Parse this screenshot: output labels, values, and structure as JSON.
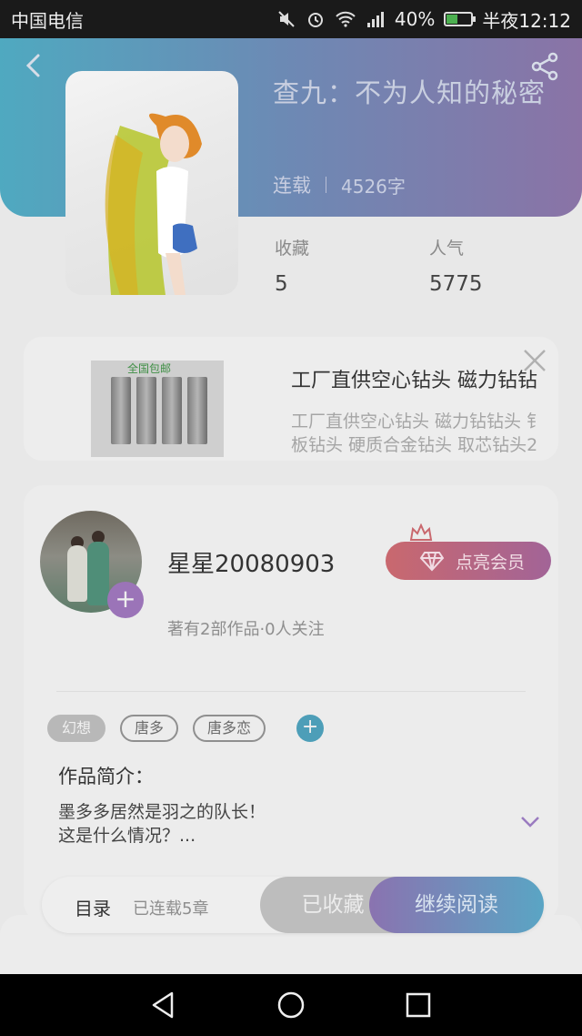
{
  "status_bar": {
    "carrier": "中国电信",
    "battery": "40%",
    "time": "半夜12:12"
  },
  "book": {
    "title": "查九：不为人知的秘密",
    "status": "连载",
    "word_count": "4526字",
    "fav_label": "收藏",
    "fav_value": "5",
    "pop_label": "人气",
    "pop_value": "5775"
  },
  "ad": {
    "title": "工厂直供空心钻头 磁力钻钻",
    "desc_line1": "工厂直供空心钻头 磁力钻钻头 钅",
    "desc_line2": "板钻头 硬质合金钻头 取芯钻头2",
    "image_tag": "全国包邮"
  },
  "author": {
    "name": "星星20080903",
    "subtitle": "著有2部作品·0人关注",
    "vip_label": "点亮会员"
  },
  "tags": [
    "幻想",
    "唐多",
    "唐多恋"
  ],
  "intro": {
    "label": "作品简介：",
    "line1": "墨多多居然是羽之的队长！",
    "line2": "这是什么情况？..."
  },
  "bottom": {
    "toc_label": "目录",
    "toc_count": "已连载5章",
    "fav_button": "已收藏",
    "read_button": "继续阅读"
  }
}
